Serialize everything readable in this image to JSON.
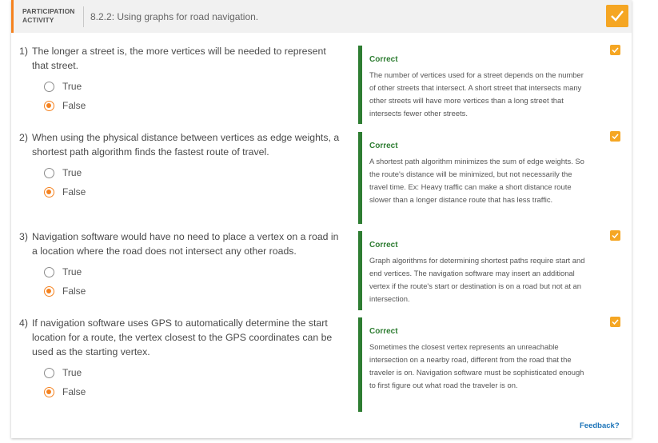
{
  "header": {
    "activity_label": "PARTICIPATION ACTIVITY",
    "title": "8.2.2: Using graphs for road navigation.",
    "complete_icon": "check-icon",
    "accent_color": "#f5821f"
  },
  "questions": [
    {
      "number": "1)",
      "text": "The longer a street is, the more vertices will be needed to represent that street.",
      "choices": [
        {
          "label": "True",
          "selected": false
        },
        {
          "label": "False",
          "selected": true
        }
      ],
      "feedback_title": "Correct",
      "feedback_body": "The number of vertices used for a street depends on the number of other streets that intersect. A short street that intersects many other streets will have more vertices than a long street that intersects fewer other streets."
    },
    {
      "number": "2)",
      "text": "When using the physical distance between vertices as edge weights, a shortest path algorithm finds the fastest route of travel.",
      "choices": [
        {
          "label": "True",
          "selected": false
        },
        {
          "label": "False",
          "selected": true
        }
      ],
      "feedback_title": "Correct",
      "feedback_body": "A shortest path algorithm minimizes the sum of edge weights. So the route's distance will be minimized, but not necessarily the travel time. Ex: Heavy traffic can make a short distance route slower than a longer distance route that has less traffic."
    },
    {
      "number": "3)",
      "text": "Navigation software would have no need to place a vertex on a road in a location where the road does not intersect any other roads.",
      "choices": [
        {
          "label": "True",
          "selected": false
        },
        {
          "label": "False",
          "selected": true
        }
      ],
      "feedback_title": "Correct",
      "feedback_body": "Graph algorithms for determining shortest paths require start and end vertices. The navigation software may insert an additional vertex if the route's start or destination is on a road but not at an intersection."
    },
    {
      "number": "4)",
      "text": "If navigation software uses GPS to automatically determine the start location for a route, the vertex closest to the GPS coordinates can be used as the starting vertex.",
      "choices": [
        {
          "label": "True",
          "selected": false
        },
        {
          "label": "False",
          "selected": true
        }
      ],
      "feedback_title": "Correct",
      "feedback_body": "Sometimes the closest vertex represents an unreachable intersection on a nearby road, different from the road that the traveler is on. Navigation software must be sophisticated enough to first figure out what road the traveler is on."
    }
  ],
  "footer": {
    "feedback_link": "Feedback?"
  }
}
